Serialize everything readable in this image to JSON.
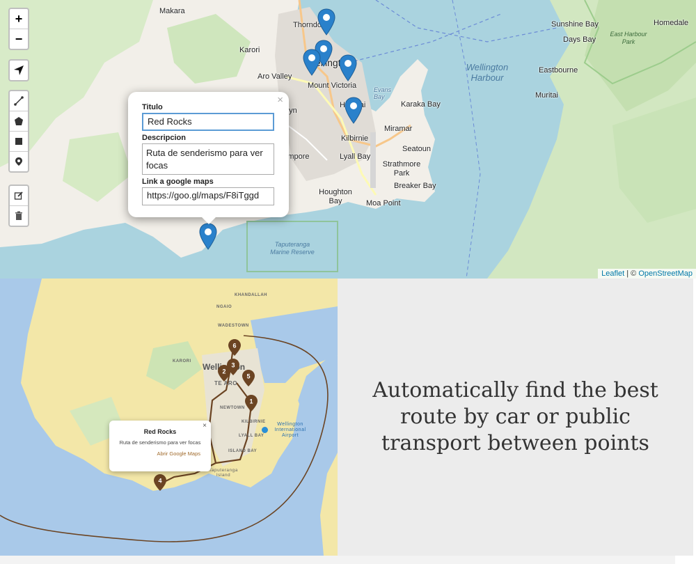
{
  "top_map": {
    "zoom_in_label": "+",
    "zoom_out_label": "−",
    "place_labels": [
      {
        "text": "Makara"
      },
      {
        "text": "Karori"
      },
      {
        "text": "Thorndon"
      },
      {
        "text": "Wellington"
      },
      {
        "text": "Aro Valley"
      },
      {
        "text": "Mount Victoria"
      },
      {
        "text": "Evans Bay"
      },
      {
        "text": "Hataitai"
      },
      {
        "text": "Karaka Bay"
      },
      {
        "text": "Miramar"
      },
      {
        "text": "Kilbirnie"
      },
      {
        "text": "Seatoun"
      },
      {
        "text": "Lyall Bay"
      },
      {
        "text": "Strathmore Park"
      },
      {
        "text": "Breaker Bay"
      },
      {
        "text": "Houghton Bay"
      },
      {
        "text": "Moa Point"
      },
      {
        "text": "Brooklyn"
      },
      {
        "text": "Berhampore"
      },
      {
        "text": "Sunshine Bay"
      },
      {
        "text": "Days Bay"
      },
      {
        "text": "Homedale"
      },
      {
        "text": "Eastbourne"
      },
      {
        "text": "Muritai"
      }
    ],
    "water_label": "Wellington Harbour",
    "park_label": "East Harbour Park",
    "reserve_label": "Taputeranga Marine Reserve",
    "popup": {
      "title_label": "Titulo",
      "title_value": "Red Rocks",
      "description_label": "Descripcion",
      "description_value": "Ruta de senderismo para ver focas",
      "link_label": "Link a google maps",
      "link_value": "https://goo.gl/maps/F8iTggd",
      "close_label": "×"
    },
    "attribution": {
      "leaflet": "Leaflet",
      "separator": " | © ",
      "osm": "OpenStreetMap"
    }
  },
  "bottom_map": {
    "place_labels": [
      {
        "text": "KHANDALLAH"
      },
      {
        "text": "NGAIO"
      },
      {
        "text": "WADESTOWN"
      },
      {
        "text": "KARORI"
      },
      {
        "text": "Wellington"
      },
      {
        "text": "TE ARO"
      },
      {
        "text": "NEWTOWN"
      },
      {
        "text": "KILBIRNIE"
      },
      {
        "text": "LYALL BAY"
      },
      {
        "text": "ISLAND BAY"
      },
      {
        "text": "Taputeranga Island"
      },
      {
        "text": "Wellington International Airport"
      }
    ],
    "markers": [
      "6",
      "3",
      "2",
      "5",
      "1",
      "4"
    ],
    "popup": {
      "title": "Red Rocks",
      "description": "Ruta de senderismo para ver focas",
      "link": "Abrir Google Maps",
      "close_label": "×"
    }
  },
  "promo": {
    "text": "Automatically find the best route by car or public transport between points"
  },
  "colors": {
    "water": "#aad3df",
    "land": "#f2efe9",
    "park": "#c8e6b4",
    "marker": "#2a81cb",
    "route": "#7a4a1f",
    "promo_bg": "#ececec"
  }
}
